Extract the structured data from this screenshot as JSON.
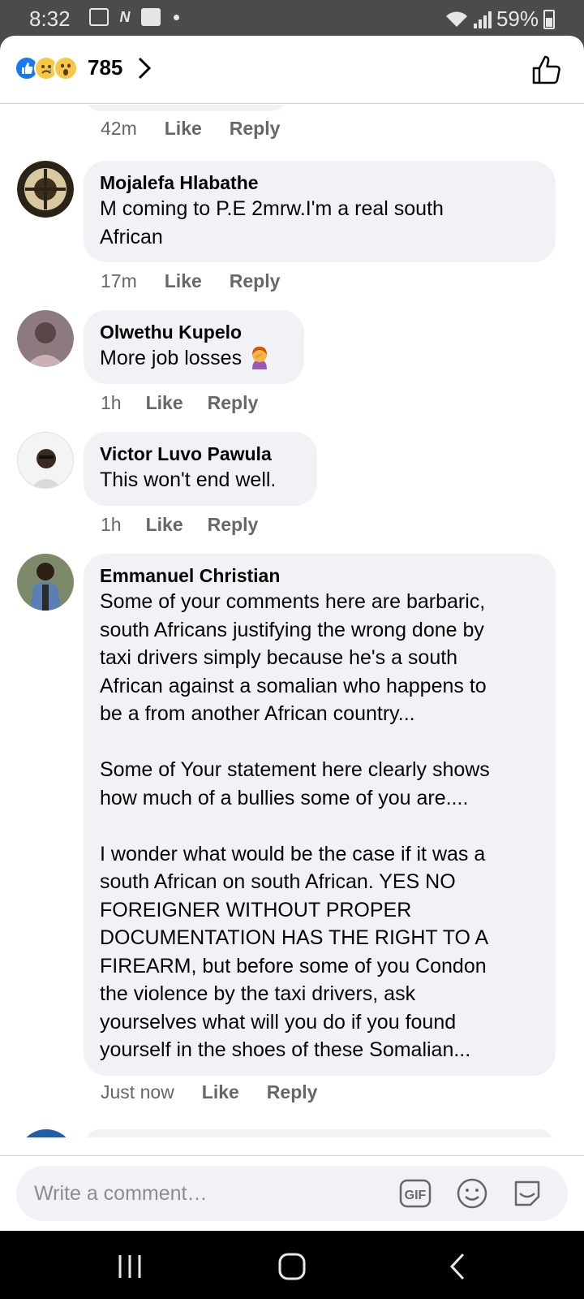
{
  "status": {
    "time": "8:32",
    "battery": "59%"
  },
  "header": {
    "reaction_count": "785"
  },
  "comments": [
    {
      "name": "Mojalefa Hlabathe",
      "text": "M coming to P.E 2mrw.I'm a real south\nAfrican",
      "time": "17m"
    },
    {
      "name": "Olwethu Kupelo",
      "text": "More job losses",
      "time": "1h"
    },
    {
      "name": "Victor Luvo Pawula",
      "text": "This won't end well.",
      "time": "1h"
    },
    {
      "name": "Emmanuel Christian",
      "text": "Some of your comments here are barbaric,\nsouth Africans justifying the wrong done by\ntaxi drivers simply because he's a south\nAfrican against a somalian who happens to\nbe a from another African country...\n\nSome of Your statement here clearly shows\nhow much of a bullies some of you are....\n\nI wonder what would be the case if it was a\nsouth African on south African. YES NO\nFOREIGNER WITHOUT PROPER\nDOCUMENTATION HAS THE RIGHT TO A\nFIREARM, but before some of you Condon\nthe violence by the taxi drivers, ask\nyourselves what will you do if you found\nyourself in the shoes of these Somalian...",
      "time": "Just now"
    }
  ],
  "top_partial": {
    "time": "42m"
  },
  "actions": {
    "like": "Like",
    "reply": "Reply"
  },
  "composer": {
    "placeholder": "Write a comment…",
    "gif_label": "GIF"
  },
  "colors": {
    "bubble": "#f0f2f5",
    "accent": "#1877f2",
    "meta": "#65676b"
  },
  "icons": [
    "like-reaction-icon",
    "sad-reaction-icon",
    "wow-reaction-icon",
    "chevron-right-icon",
    "thumbs-up-outline-icon",
    "gif-icon",
    "emoji-icon",
    "sticker-icon",
    "recent-apps-icon",
    "home-icon",
    "back-icon"
  ]
}
